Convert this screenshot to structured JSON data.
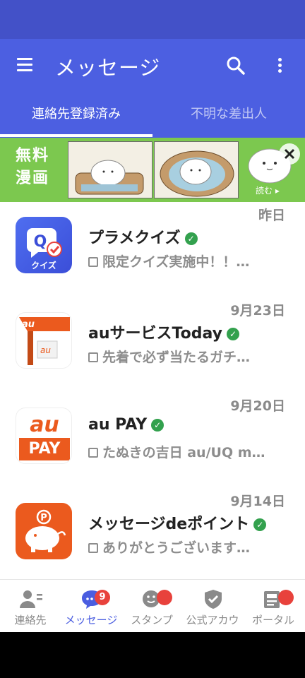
{
  "header": {
    "title": "メッセージ",
    "icons": [
      "hamburger-menu-icon",
      "search-icon",
      "more-vert-icon"
    ]
  },
  "tabs": [
    {
      "label": "連絡先登録済み",
      "active": true
    },
    {
      "label": "不明な差出人",
      "active": false
    }
  ],
  "banner": {
    "title_line1": "無料",
    "title_line2": "漫画",
    "cta": "読む ▸"
  },
  "messages": [
    {
      "name": "プラメクイズ",
      "verified": true,
      "date": "昨日",
      "preview": "限定クイズ実施中！！…",
      "icon_text": "クイズ"
    },
    {
      "name": "auサービスToday",
      "verified": true,
      "date": "9月23日",
      "preview": "先着で必ず当たるガチ…",
      "icon_text": "au"
    },
    {
      "name": "au PAY",
      "verified": true,
      "date": "9月20日",
      "preview": "たぬきの吉日 au/UQ m…",
      "icon_text1": "au",
      "icon_text2": "PAY"
    },
    {
      "name": "メッセージdeポイント",
      "verified": true,
      "date": "9月14日",
      "preview": "ありがとうございます…",
      "icon_text": "P"
    }
  ],
  "bottom_nav": [
    {
      "label": "連絡先",
      "icon": "contacts-icon",
      "active": false
    },
    {
      "label": "メッセージ",
      "icon": "message-bubble-icon",
      "active": true,
      "badge": "9"
    },
    {
      "label": "スタンプ",
      "icon": "stamp-icon",
      "active": false
    },
    {
      "label": "公式アカウ",
      "icon": "shield-check-icon",
      "active": false
    },
    {
      "label": "ポータル",
      "icon": "portal-icon",
      "active": false
    }
  ],
  "colors": {
    "primary": "#4c5fe1",
    "statusbar": "#4351c8",
    "banner_green": "#7cc84f",
    "verified_green": "#33a14e",
    "badge_red": "#e8423c",
    "au_orange": "#eb5a1e"
  }
}
